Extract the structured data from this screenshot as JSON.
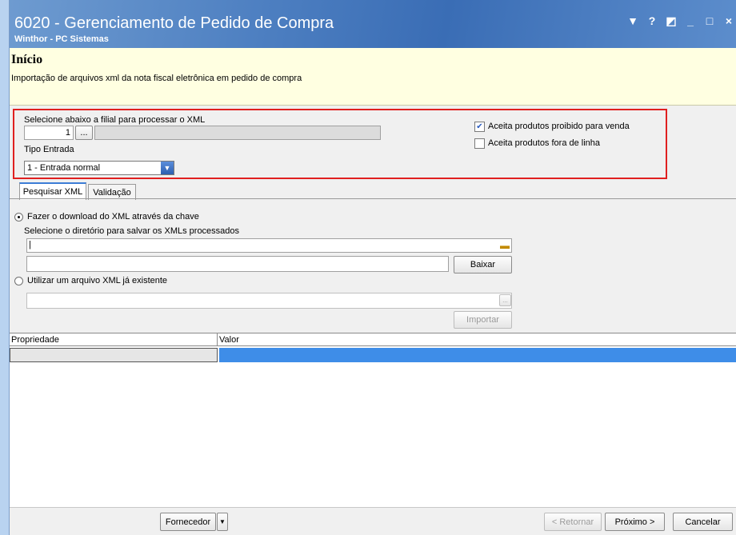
{
  "window": {
    "title": "6020 - Gerenciamento de Pedido de Compra",
    "subtitle": "Winthor - PC Sistemas",
    "controls": [
      "▼",
      "?",
      "◩",
      "_",
      "□",
      "×"
    ]
  },
  "header": {
    "heading": "Início",
    "description": "Importação de arquivos xml da nota fiscal eletrônica em pedido de compra"
  },
  "filial": {
    "label": "Selecione abaixo a filial para processar o XML",
    "code": "1",
    "browse_label": "...",
    "name": ""
  },
  "tipo_entrada": {
    "label": "Tipo Entrada",
    "selected": "1 - Entrada normal"
  },
  "options": {
    "proibido_label": "Aceita produtos proibido para venda",
    "proibido_checked": true,
    "fora_linha_label": "Aceita produtos fora de linha",
    "fora_linha_checked": false
  },
  "tabs": [
    {
      "label": "Pesquisar XML",
      "active": true
    },
    {
      "label": "Validação",
      "active": false
    }
  ],
  "download": {
    "radio_label": "Fazer o download do XML através da chave",
    "dir_label": "Selecione o diretório para salvar os XMLs processados",
    "dir_value": "|",
    "chave_value": "",
    "button": "Baixar"
  },
  "existing": {
    "radio_label": "Utilizar um arquivo XML já existente",
    "file_value": "",
    "browse_label": "...",
    "button": "Importar"
  },
  "grid": {
    "col_property": "Propriedade",
    "col_value": "Valor"
  },
  "footer": {
    "fornecedor": "Fornecedor",
    "retornar": "< Retornar",
    "proximo": "Próximo >",
    "cancelar": "Cancelar"
  }
}
